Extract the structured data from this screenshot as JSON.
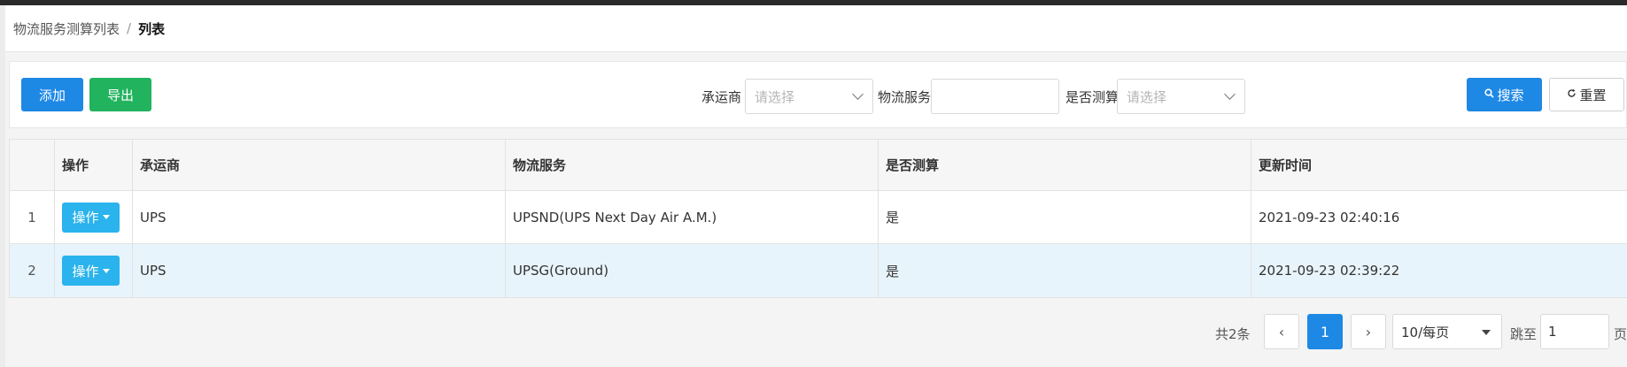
{
  "breadcrumb": {
    "parent": "物流服务测算列表",
    "separator": "/",
    "current": "列表"
  },
  "toolbar": {
    "add_label": "添加",
    "export_label": "导出",
    "carrier_label": "承运商",
    "carrier_placeholder": "请选择",
    "service_label": "物流服务",
    "service_value": "",
    "calculated_label": "是否测算",
    "calculated_placeholder": "请选择",
    "search_label": "搜索",
    "reset_label": "重置"
  },
  "table": {
    "columns": [
      "",
      "操作",
      "承运商",
      "物流服务",
      "是否测算",
      "更新时间"
    ],
    "rows": [
      {
        "index": "1",
        "action": "操作",
        "carrier": "UPS",
        "service": "UPSND(UPS Next Day Air A.M.)",
        "calculated": "是",
        "updated": "2021-09-23 02:40:16"
      },
      {
        "index": "2",
        "action": "操作",
        "carrier": "UPS",
        "service": "UPSG(Ground)",
        "calculated": "是",
        "updated": "2021-09-23 02:39:22"
      }
    ]
  },
  "pagination": {
    "total": "共2条",
    "prev": "‹",
    "current_page": "1",
    "next": "›",
    "page_size": "10/每页",
    "goto_label": "跳至",
    "goto_value": "1",
    "page_unit": "页"
  },
  "colors": {
    "primary": "#1e88e5",
    "success": "#22b35e",
    "info": "#2ab3ec",
    "row_highlight": "#e8f4fb"
  }
}
